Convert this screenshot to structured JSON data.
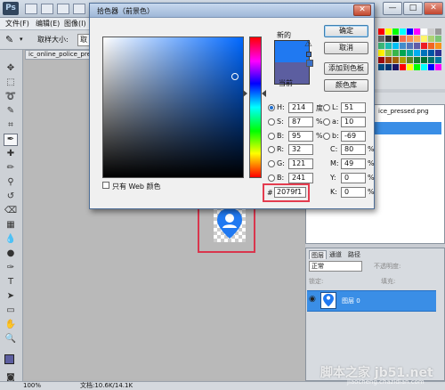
{
  "app": {
    "logo": "Ps",
    "window_controls": {
      "minimize": "—",
      "maximize": "□",
      "close": "✕"
    }
  },
  "menu": [
    "文件(F)",
    "编辑(E)",
    "图像(I)"
  ],
  "options": {
    "sample_size_label": "取样大小:",
    "sample_size_value": "取样"
  },
  "document": {
    "tab_name": "ic_online_police_pressed",
    "zoom": "100%",
    "doc_size": "文档:10.6K/14.1K"
  },
  "dialog": {
    "title": "拾色器（前景色）",
    "new_label": "新的",
    "current_label": "当前",
    "new_color": "#2079f1",
    "current_color": "#5c5ea0",
    "buttons": {
      "ok": "确定",
      "cancel": "取消",
      "add_to_swatches": "添加到色板",
      "color_libraries": "颜色库"
    },
    "web_only_label": "只有 Web 颜色",
    "fields": {
      "H": {
        "label": "H:",
        "value": "214",
        "unit": "度"
      },
      "S": {
        "label": "S:",
        "value": "87",
        "unit": "%"
      },
      "B": {
        "label": "B:",
        "value": "95",
        "unit": "%"
      },
      "R": {
        "label": "R:",
        "value": "32"
      },
      "G": {
        "label": "G:",
        "value": "121"
      },
      "B2": {
        "label": "B:",
        "value": "241"
      },
      "L": {
        "label": "L:",
        "value": "51"
      },
      "a": {
        "label": "a:",
        "value": "10"
      },
      "b": {
        "label": "b:",
        "value": "-69"
      },
      "C": {
        "label": "C:",
        "value": "80",
        "unit": "%"
      },
      "M": {
        "label": "M:",
        "value": "49",
        "unit": "%"
      },
      "Y": {
        "label": "Y:",
        "value": "0",
        "unit": "%"
      },
      "K": {
        "label": "K:",
        "value": "0",
        "unit": "%"
      }
    },
    "hex_label": "#",
    "hex_value": "2079f1"
  },
  "history": {
    "filename": "ice_pressed.png"
  },
  "layers": {
    "tabs": [
      "图层",
      "通道",
      "路径"
    ],
    "blend_mode": "正常",
    "opacity_label": "不透明度:",
    "lock_label": "锁定:",
    "fill_label": "填充:",
    "layer_name": "图层 0"
  },
  "watermark": {
    "main": "脚本之家 jb51.net",
    "sub": "jiaocheng.chazidian.com"
  }
}
